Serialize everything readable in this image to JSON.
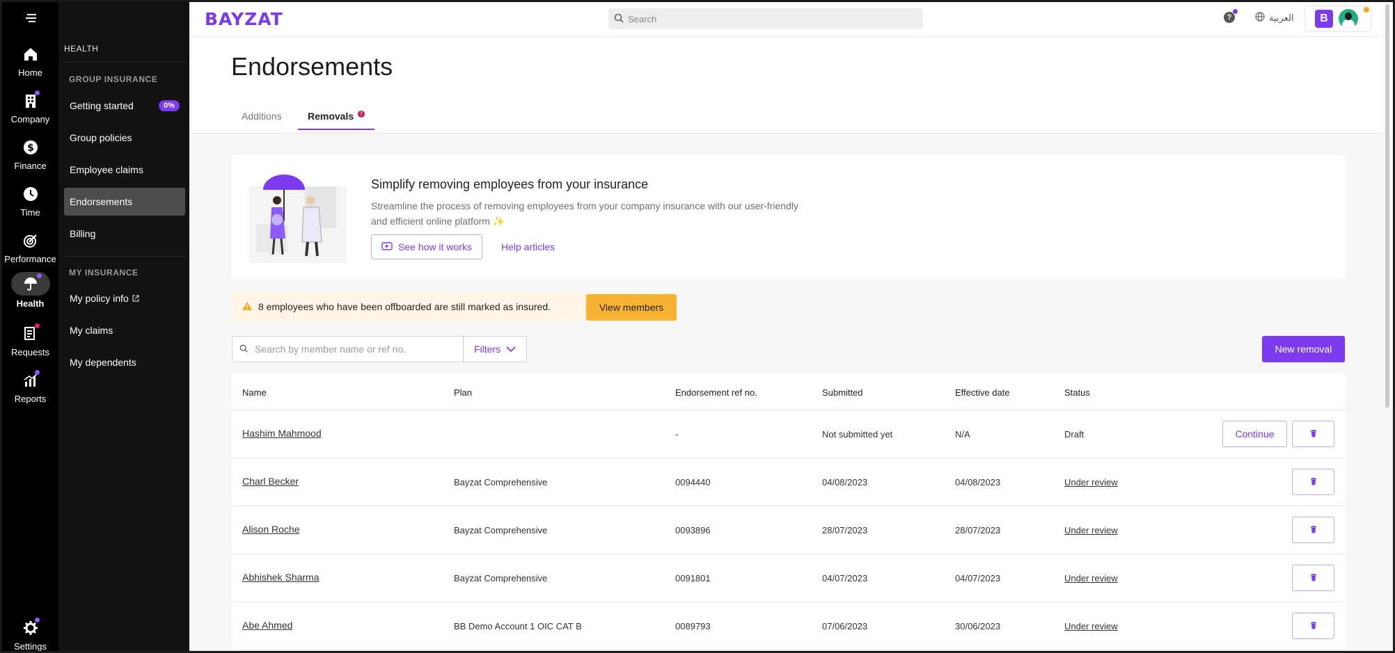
{
  "brand": {
    "logo": "BAYZAT",
    "accent": "#7c3aed"
  },
  "rail": {
    "items": [
      {
        "label": "Home",
        "icon": "home-icon"
      },
      {
        "label": "Company",
        "icon": "building-icon",
        "dot": "#8b5cf6"
      },
      {
        "label": "Finance",
        "icon": "dollar-icon"
      },
      {
        "label": "Time",
        "icon": "clock-icon"
      },
      {
        "label": "Performance",
        "icon": "target-icon"
      },
      {
        "label": "Health",
        "icon": "umbrella-icon",
        "dot": "#8b5cf6",
        "active": true
      },
      {
        "label": "Requests",
        "icon": "requests-icon",
        "dot": "#e0245e"
      },
      {
        "label": "Reports",
        "icon": "chart-icon",
        "dot": "#8b5cf6"
      },
      {
        "label": "Settings",
        "icon": "gear-icon",
        "dot": "#8b5cf6"
      }
    ]
  },
  "sidebar": {
    "section": "HEALTH",
    "group_insurance": "GROUP INSURANCE",
    "items": [
      {
        "label": "Getting started",
        "badge": "0%"
      },
      {
        "label": "Group policies"
      },
      {
        "label": "Employee claims"
      },
      {
        "label": "Endorsements",
        "active": true
      },
      {
        "label": "Billing"
      }
    ],
    "my_insurance": "MY INSURANCE",
    "my_items": [
      {
        "label": "My policy info",
        "external": true
      },
      {
        "label": "My claims"
      },
      {
        "label": "My dependents"
      }
    ]
  },
  "topbar": {
    "search_placeholder": "Search",
    "help": "?",
    "language": "العربية",
    "account_initial": "B"
  },
  "page": {
    "title": "Endorsements",
    "tabs": [
      {
        "label": "Additions"
      },
      {
        "label": "Removals",
        "alert": "!"
      }
    ]
  },
  "promo": {
    "title": "Simplify removing employees from your insurance",
    "description": "Streamline the process of removing employees from your company insurance with our user-friendly and efficient online platform ✨",
    "primary_link": "See how it works",
    "secondary_link": "Help articles"
  },
  "warning": {
    "text": "8 employees who have been offboarded are still marked as insured.",
    "button": "View members"
  },
  "table_controls": {
    "search_placeholder": "Search by member name or ref no.",
    "filters": "Filters",
    "new_removal": "New removal"
  },
  "table": {
    "columns": [
      "Name",
      "Plan",
      "Endorsement ref no.",
      "Submitted",
      "Effective date",
      "Status"
    ],
    "rows": [
      {
        "name": "Hashim Mahmood",
        "plan": "",
        "ref": "-",
        "submitted": "Not submitted yet",
        "effective": "N/A",
        "status": "Draft",
        "action": "Continue"
      },
      {
        "name": "Charl Becker",
        "plan": "Bayzat Comprehensive",
        "ref": "0094440",
        "submitted": "04/08/2023",
        "effective": "04/08/2023",
        "status": "Under review"
      },
      {
        "name": "Alison Roche",
        "plan": "Bayzat Comprehensive",
        "ref": "0093896",
        "submitted": "28/07/2023",
        "effective": "28/07/2023",
        "status": "Under review"
      },
      {
        "name": "Abhishek Sharma",
        "plan": "Bayzat Comprehensive",
        "ref": "0091801",
        "submitted": "04/07/2023",
        "effective": "04/07/2023",
        "status": "Under review"
      },
      {
        "name": "Abe Ahmed",
        "plan": "BB Demo Account 1 OIC CAT B",
        "ref": "0089793",
        "submitted": "07/06/2023",
        "effective": "30/06/2023",
        "status": "Under review"
      }
    ]
  }
}
